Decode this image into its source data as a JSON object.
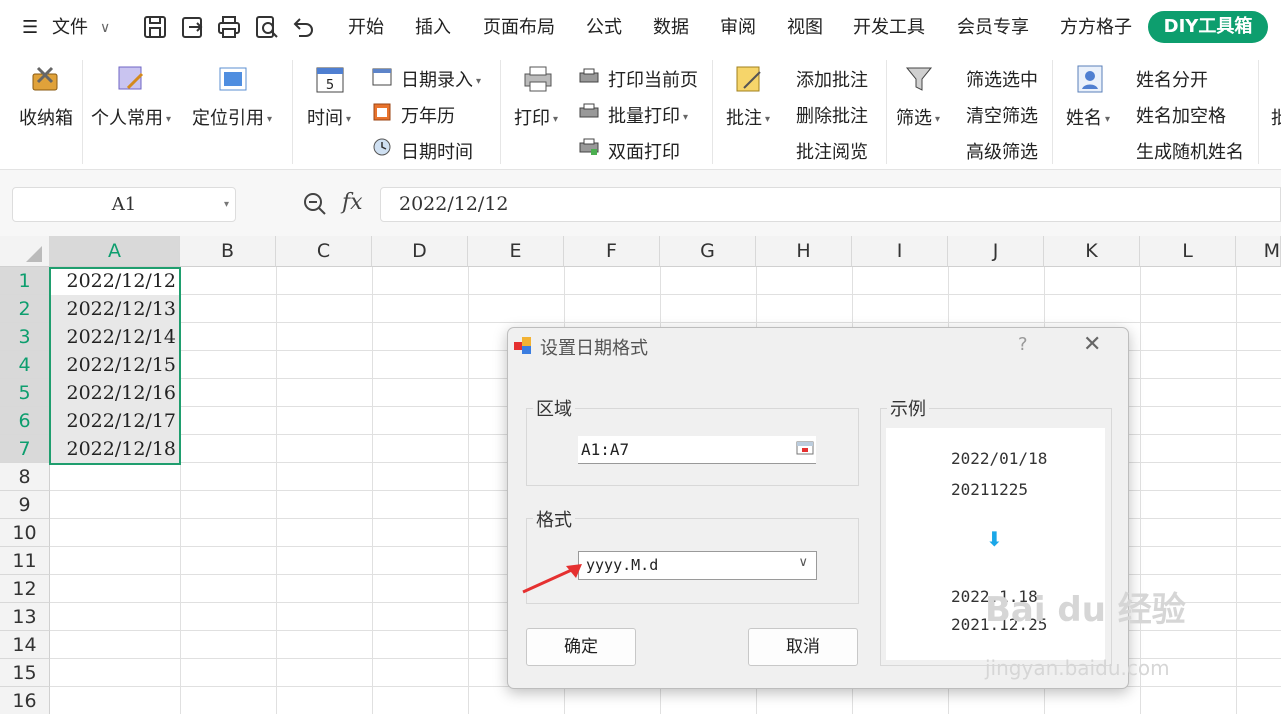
{
  "menu": {
    "file": "文件",
    "tabs": [
      "开始",
      "插入",
      "页面布局",
      "公式",
      "数据",
      "审阅",
      "视图",
      "开发工具",
      "会员专享",
      "方方格子"
    ],
    "diy_tab": "DIY工具箱"
  },
  "ribbon": {
    "storage": "收纳箱",
    "personal": "个人常用",
    "locate": "定位引用",
    "time": "时间",
    "date_entry": "日期录入",
    "calendar": "万年历",
    "datetime": "日期时间",
    "print": "打印",
    "print_page": "打印当前页",
    "batch_print": "批量打印",
    "duplex_print": "双面打印",
    "comment": "批注",
    "add_comment": "添加批注",
    "del_comment": "删除批注",
    "view_comment": "批注阅览",
    "filter": "筛选",
    "filter_sel": "筛选选中",
    "clear_filter": "清空筛选",
    "adv_filter": "高级筛选",
    "name": "姓名",
    "name_split": "姓名分开",
    "name_space": "姓名加空格",
    "rand_name": "生成随机姓名",
    "cut": "批"
  },
  "formula_bar": {
    "cell_ref": "A1",
    "fx": "fx",
    "value": "2022/12/12"
  },
  "columns": [
    "A",
    "B",
    "C",
    "D",
    "E",
    "F",
    "G",
    "H",
    "I",
    "J",
    "K",
    "L",
    "M"
  ],
  "rows": [
    "1",
    "2",
    "3",
    "4",
    "5",
    "6",
    "7",
    "8",
    "9",
    "10",
    "11",
    "12",
    "13",
    "14",
    "15",
    "16"
  ],
  "cells_a": [
    "2022/12/12",
    "2022/12/13",
    "2022/12/14",
    "2022/12/15",
    "2022/12/16",
    "2022/12/17",
    "2022/12/18"
  ],
  "dialog": {
    "title": "设置日期格式",
    "help": "?",
    "close": "✕",
    "range_label": "区域",
    "range_value": "A1:A7",
    "format_label": "格式",
    "format_value": "yyyy.M.d",
    "example_label": "示例",
    "ex_in1": "2022/01/18",
    "ex_in2": "20211225",
    "arrow": "⬇",
    "ex_out1": "2022.1.18",
    "ex_out2": "2021.12.25",
    "ok": "确定",
    "cancel": "取消"
  },
  "watermark": {
    "brand": "Bai du 经验",
    "url": "jingyan.baidu.com"
  },
  "colors": {
    "accent": "#0d9e6e",
    "selection": "#1f9e6e",
    "arrow": "#e53030"
  }
}
